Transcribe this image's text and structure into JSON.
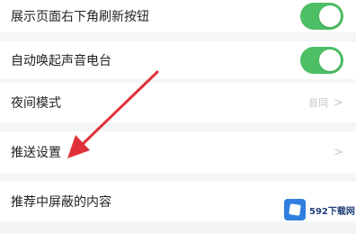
{
  "settings": {
    "rows": [
      {
        "label": "展示页面右下角刷新按钮",
        "control": "toggle",
        "on": true
      },
      {
        "label": "自动唤起声音电台",
        "control": "toggle",
        "on": true
      },
      {
        "label": "夜间模式",
        "value": "音同",
        "chevron": ">"
      },
      {
        "label": "推送设置",
        "chevron": ">"
      },
      {
        "label": "推荐中屏蔽的内容"
      }
    ]
  },
  "colors": {
    "toggle_on": "#4cbf65",
    "annotation_arrow": "#e0313a"
  },
  "watermark": {
    "text": "592下载网",
    "icon": "logo-icon"
  }
}
